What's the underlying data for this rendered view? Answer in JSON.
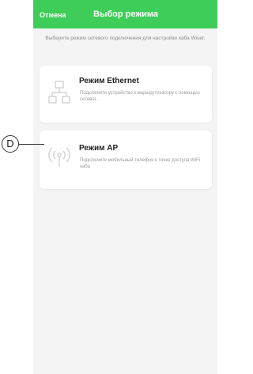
{
  "header": {
    "cancel_label": "Отмена",
    "title": "Выбор режима"
  },
  "instruction": "Выберите режим сетевого подключения для настройки хаба Wiser.",
  "modes": [
    {
      "title": "Режим Ethernet",
      "description": "Подключите устройство к маршрутизатору с помощью сетевог...",
      "icon": "network-icon"
    },
    {
      "title": "Режим AP",
      "description": "Подключите мобильный телефон к точке доступа WiFi хаба",
      "icon": "wireless-signal-icon"
    }
  ],
  "callout": {
    "label": "D"
  },
  "colors": {
    "header": "#3dcd58",
    "background": "#f3f4f3",
    "card": "#ffffff",
    "icon": "#d2d2d2"
  }
}
